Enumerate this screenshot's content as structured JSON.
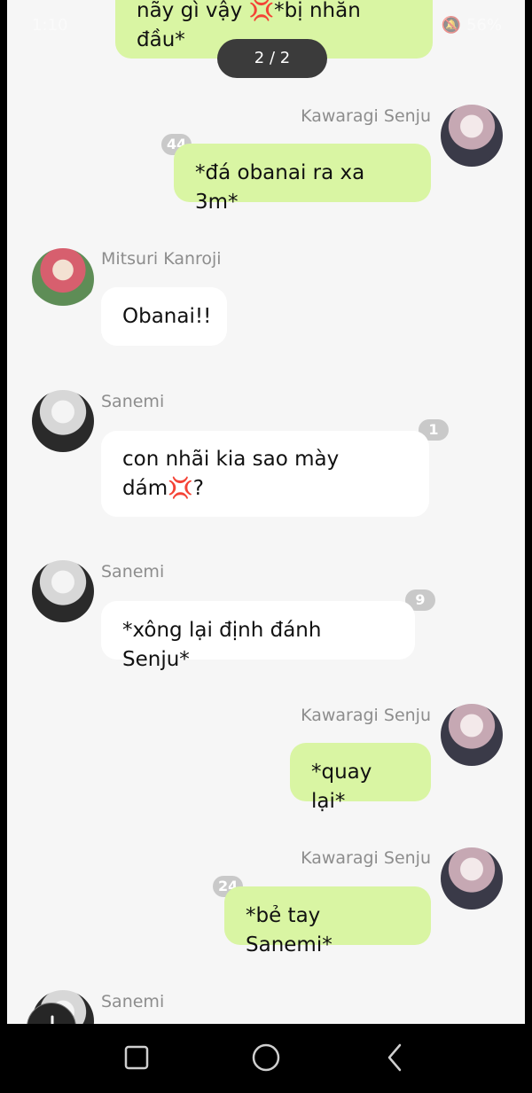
{
  "status_bar": {
    "time": "1:10",
    "right": "🔕 56%"
  },
  "pager": "2 / 2",
  "top_message": {
    "line1": "nãy gì vậy 💢*bị nhăn",
    "line2": "đầu*"
  },
  "messages": [
    {
      "sender": "Kawaragi Senju",
      "text": "*đá obanai ra xa 3m*",
      "badge": "44"
    },
    {
      "sender": "Mitsuri Kanroji",
      "text": "Obanai!!"
    },
    {
      "sender": "Sanemi",
      "line1": "con nhãi kia sao mày",
      "line2": "dám💢?",
      "badge": "1"
    },
    {
      "sender": "Sanemi",
      "text": "*xông lại định đánh Senju*",
      "badge": "9"
    },
    {
      "sender": "Kawaragi Senju",
      "text": "*quay lại*"
    },
    {
      "sender": "Kawaragi Senju",
      "text": "*bẻ tay Sanemi*",
      "badge": "24"
    },
    {
      "sender": "Sanemi"
    }
  ],
  "colors": {
    "my_bubble": "#d9f5a3",
    "other_bubble": "#ffffff",
    "background": "#f6f6f6"
  },
  "icons": [
    "download-icon",
    "recent-apps-icon",
    "home-icon",
    "back-icon"
  ]
}
